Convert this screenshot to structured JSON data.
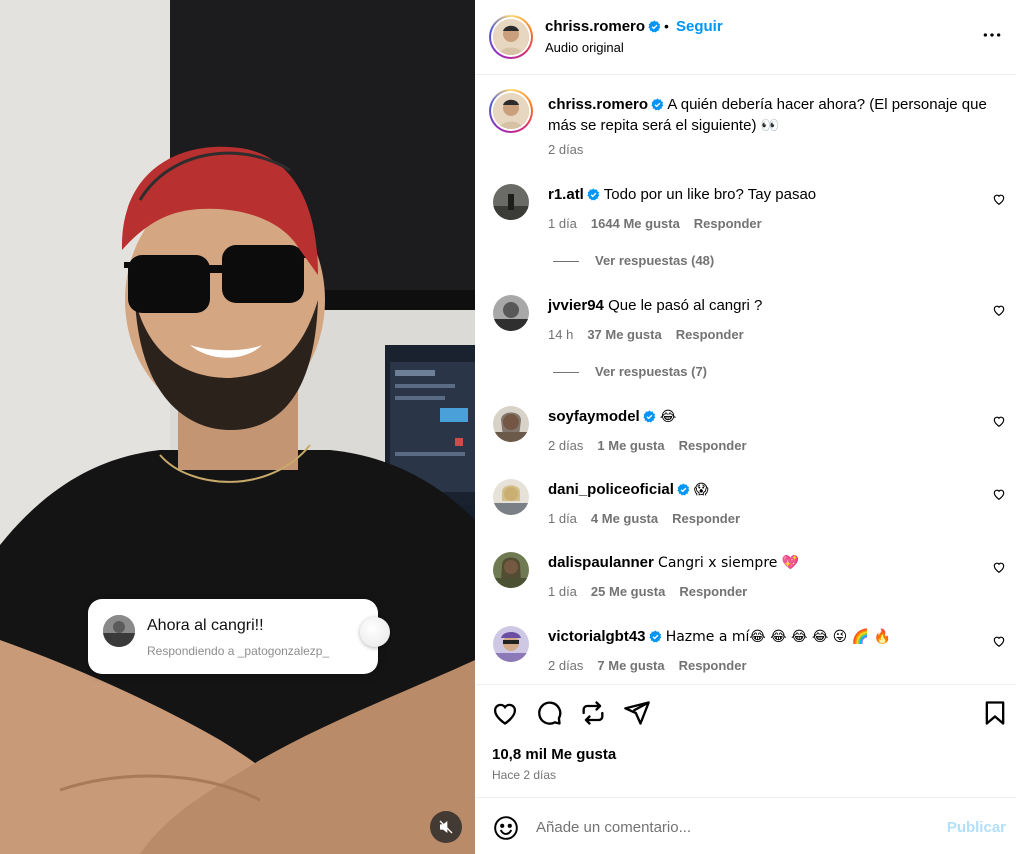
{
  "video": {
    "sticker": {
      "text": "Ahora al cangri!!",
      "subtext": "Respondiendo a _patogonzalezp_"
    }
  },
  "header": {
    "username": "chriss.romero",
    "separator": "•",
    "follow_label": "Seguir",
    "subtitle": "Audio original"
  },
  "caption": {
    "username": "chriss.romero",
    "text": "A quién debería hacer ahora? (El personaje que más se repita será el siguiente) 👀",
    "time": "2 días"
  },
  "comments": [
    {
      "username": "r1.atl",
      "verified": true,
      "text": "Todo por un like bro? Tay pasao",
      "time": "1 día",
      "likes": "1644 Me gusta",
      "reply": "Responder",
      "view_replies": "Ver respuestas (48)"
    },
    {
      "username": "jvvier94",
      "verified": false,
      "text": "Que le pasó al cangri ?",
      "time": "14 h",
      "likes": "37 Me gusta",
      "reply": "Responder",
      "view_replies": "Ver respuestas (7)"
    },
    {
      "username": "soyfaymodel",
      "verified": true,
      "text": "😂",
      "time": "2 días",
      "likes": "1 Me gusta",
      "reply": "Responder"
    },
    {
      "username": "dani_policeoficial",
      "verified": true,
      "text": "😱",
      "time": "1 día",
      "likes": "4 Me gusta",
      "reply": "Responder"
    },
    {
      "username": "dalispaulanner",
      "verified": false,
      "text": "Cangri x siempre 💖",
      "time": "1 día",
      "likes": "25 Me gusta",
      "reply": "Responder"
    },
    {
      "username": "victorialgbt43",
      "verified": true,
      "text": "Hazme a mí😂 😂 😂 😂  😜 🌈 🔥",
      "time": "2 días",
      "likes": "7 Me gusta",
      "reply": "Responder"
    }
  ],
  "actions": {
    "likes": "10,8 mil Me gusta",
    "when": "Hace 2 días"
  },
  "composer": {
    "placeholder": "Añade un comentario...",
    "publish_label": "Publicar"
  },
  "colors": {
    "accent": "#0095f6",
    "publish_disabled": "#b2dffc",
    "secondary_text": "#737373"
  }
}
